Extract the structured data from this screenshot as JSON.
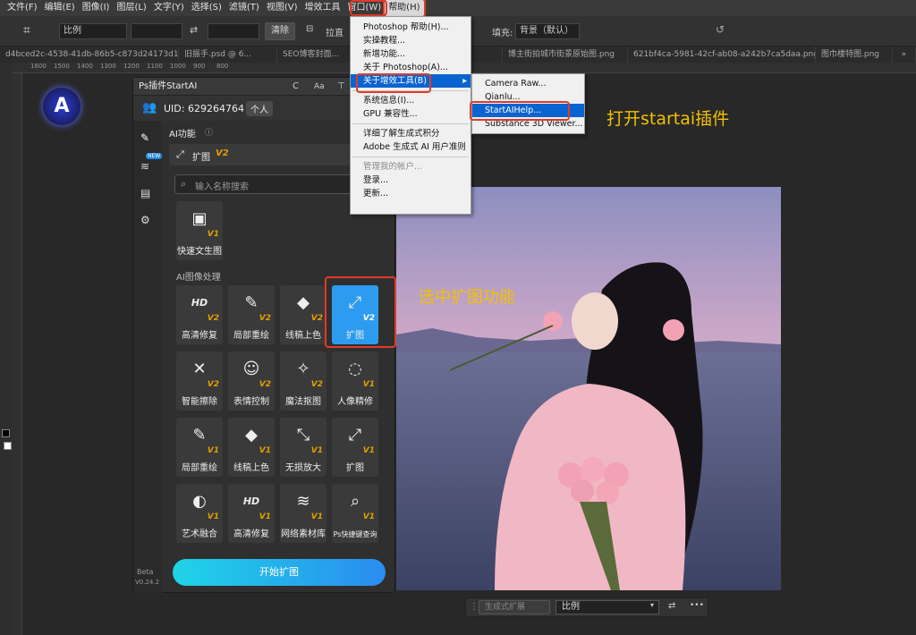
{
  "menubar": [
    "文件(F)",
    "编辑(E)",
    "图像(I)",
    "图层(L)",
    "文字(Y)",
    "选择(S)",
    "滤镜(T)",
    "视图(V)",
    "增效工具",
    "窗口(W)",
    "帮助(H)"
  ],
  "options": {
    "ratio": "比例",
    "clear": "清除",
    "straighten": "拉直",
    "fill_label": "填充:",
    "fill_value": "背景（默认）"
  },
  "tabs": [
    "d4bced2c-4538-41db-86b5-c873d24173d1.jpg",
    "旧振手.psd @ 6...",
    "SEO博客封面...",
    "...png",
    "博主街拍城市街景原始图.png",
    "621bf4ca-5981-42cf-ab08-a242b7ca5daa.png",
    "图巾楼特图.png"
  ],
  "ruler": [
    "1600",
    "1500",
    "1400",
    "1300",
    "1200",
    "1100",
    "1000",
    "900",
    "800"
  ],
  "panel": {
    "title": "Ps插件StartAI",
    "header_icons": [
      "C",
      "Aa"
    ],
    "uid": "UID: 629264764",
    "account_badge": "个人",
    "ai_functions": "AI功能",
    "feature_name": "扩图",
    "feature_version": "V2",
    "search_placeholder": "输入名称搜索",
    "new_badge": "NEW",
    "quick_gen": {
      "label": "快速文生图",
      "ver": "V1"
    },
    "section": "AI图像处理",
    "tiles": [
      {
        "label": "高清修复",
        "ver": "V2",
        "icon": "HD"
      },
      {
        "label": "局部重绘",
        "ver": "V2",
        "icon": "✎"
      },
      {
        "label": "线稿上色",
        "ver": "V2",
        "icon": "◆"
      },
      {
        "label": "扩图",
        "ver": "V2",
        "icon": "⤢"
      },
      {
        "label": "智能擦除",
        "ver": "V2",
        "icon": "✕"
      },
      {
        "label": "表情控制",
        "ver": "V2",
        "icon": "☺"
      },
      {
        "label": "魔法抠图",
        "ver": "V2",
        "icon": "✧"
      },
      {
        "label": "人像精修",
        "ver": "V1",
        "icon": "◌"
      },
      {
        "label": "局部重绘",
        "ver": "V1",
        "icon": "✎"
      },
      {
        "label": "线稿上色",
        "ver": "V1",
        "icon": "◆"
      },
      {
        "label": "无损放大",
        "ver": "V1",
        "icon": "⤡"
      },
      {
        "label": "扩图",
        "ver": "V1",
        "icon": "⤢"
      },
      {
        "label": "艺术融合",
        "ver": "V1",
        "icon": "◐"
      },
      {
        "label": "高清修复",
        "ver": "V1",
        "icon": "HD"
      },
      {
        "label": "网络素材库",
        "ver": "V1",
        "icon": "≋"
      },
      {
        "label": "Ps快捷键查询",
        "ver": "V1",
        "icon": "⌕"
      }
    ],
    "beta": "Beta",
    "version": "V0.24.2",
    "start_button": "开始扩图"
  },
  "help_menu": {
    "items": [
      "Photoshop 帮助(H)...",
      "实操教程...",
      "新增功能...",
      "关于 Photoshop(A)...",
      "关于增效工具(B)",
      "系统信息(I)...",
      "GPU 兼容性...",
      "详细了解生成式积分",
      "Adobe 生成式 AI 用户准则",
      "管理我的帐户...",
      "登录...",
      "更新..."
    ]
  },
  "submenu": {
    "items": [
      "Camera Raw...",
      "Qianlu...",
      "StartAIHelp...",
      "Substance 3D Viewer..."
    ]
  },
  "annotations": {
    "open_plugin": "打开startai插件",
    "select_expand": "选中扩图功能"
  },
  "bottom_bar": {
    "generative_expand": "生成式扩展",
    "ratio": "比例",
    "more": "•••"
  }
}
